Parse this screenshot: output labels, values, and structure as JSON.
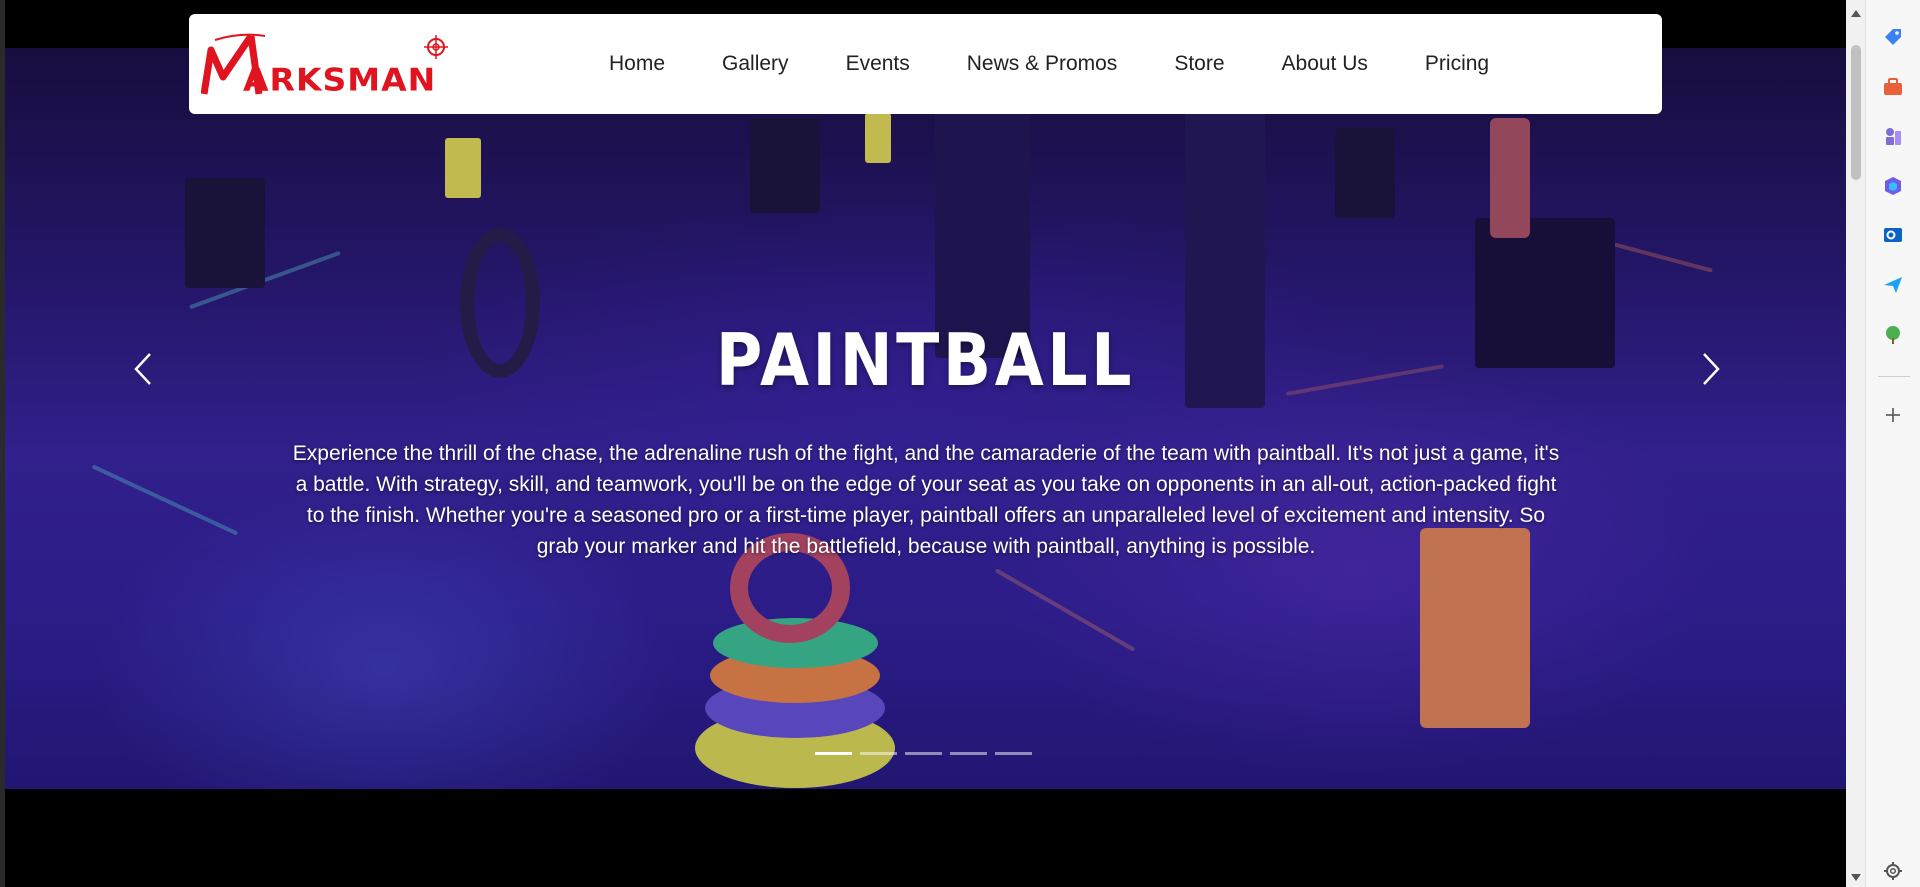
{
  "brand": {
    "logo_text": "ARKSMAN",
    "logo_letter": "M",
    "color": "#e0141e"
  },
  "nav": {
    "items": [
      {
        "label": "Home"
      },
      {
        "label": "Gallery"
      },
      {
        "label": "Events"
      },
      {
        "label": "News & Promos"
      },
      {
        "label": "Store"
      },
      {
        "label": "About Us"
      },
      {
        "label": "Pricing"
      }
    ]
  },
  "hero": {
    "title": "PAINTBALL",
    "description": "Experience the thrill of the chase, the adrenaline rush of the fight, and the camaraderie of the team with paintball. It's not just a game, it's a battle. With strategy, skill, and teamwork, you'll be on the edge of your seat as you take on opponents in an all-out, action-packed fight to the finish. Whether you're a seasoned pro or a first-time player, paintball offers an unparalleled level of excitement and intensity. So grab your marker and hit the battlefield, because with paintball, anything is possible.",
    "slide_count": 5,
    "active_slide": 1
  },
  "sidebar_icons": [
    "tag-icon",
    "briefcase-icon",
    "chess-icon",
    "copilot-icon",
    "outlook-icon",
    "send-icon",
    "tree-icon",
    "add-icon",
    "settings-icon"
  ],
  "colors": {
    "hero_bg": "#2a1a78",
    "nav_bg": "#ffffff",
    "page_bg": "#000000"
  }
}
